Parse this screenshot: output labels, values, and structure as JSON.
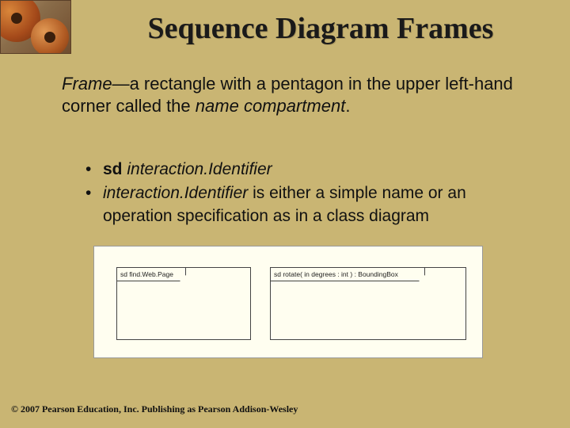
{
  "title": "Sequence Diagram Frames",
  "desc": {
    "frame_word": "Frame",
    "dash_text": "—a rectangle with a pentagon in the upper left-hand corner called the ",
    "name_word": "name",
    "compartment_word": "compartment",
    "period": "."
  },
  "bullets": {
    "b1_sd": "sd",
    "b1_ii": " interaction.Identifier",
    "b2_ii": "interaction.Identifier",
    "b2_rest": " is either a simple name or an operation specification as in a class diagram"
  },
  "figure": {
    "left_label": "sd find.Web.Page",
    "right_label": "sd rotate( in degrees : int ) : BoundingBox"
  },
  "copyright": "© 2007 Pearson Education, Inc. Publishing as Pearson Addison-Wesley"
}
